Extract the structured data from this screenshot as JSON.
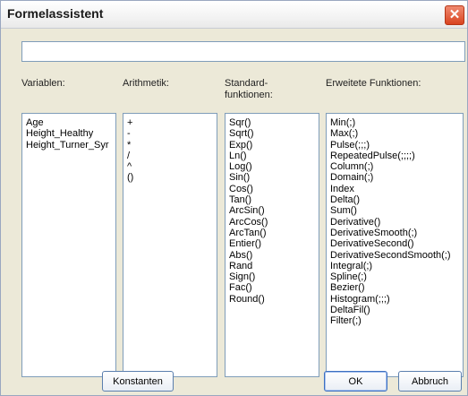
{
  "window": {
    "title": "Formelassistent"
  },
  "formula": {
    "value": ""
  },
  "columns": {
    "variables": {
      "header": "Variablen:",
      "items": [
        "Age",
        "Height_Healthy",
        "Height_Turner_Syr"
      ]
    },
    "arithmetic": {
      "header": "Arithmetik:",
      "items": [
        "+",
        "-",
        "*",
        "/",
        "^",
        "()"
      ]
    },
    "standard": {
      "header_line1": "Standard-",
      "header_line2": "funktionen:",
      "items": [
        "Sqr()",
        "Sqrt()",
        "Exp()",
        "Ln()",
        "Log()",
        "Sin()",
        "Cos()",
        "Tan()",
        "ArcSin()",
        "ArcCos()",
        "ArcTan()",
        "Entier()",
        "Abs()",
        "Rand",
        "Sign()",
        "Fac()",
        "Round()"
      ]
    },
    "extended": {
      "header": "Erweitete Funktionen:",
      "items": [
        "Min(;)",
        "Max(;)",
        "Pulse(;;;)",
        "RepeatedPulse(;;;;)",
        "Column(;)",
        "Domain(;)",
        "Index",
        "Delta()",
        "Sum()",
        "Derivative()",
        "DerivativeSmooth(;)",
        "DerivativeSecond()",
        "DerivativeSecondSmooth(;)",
        "Integral(;)",
        "Spline(;)",
        "Bezier()",
        "Histogram(;;;)",
        "DeltaFil()",
        "Filter(;)"
      ]
    }
  },
  "buttons": {
    "constants": "Konstanten",
    "ok": "OK",
    "cancel": "Abbruch",
    "close_symbol": "✕"
  }
}
